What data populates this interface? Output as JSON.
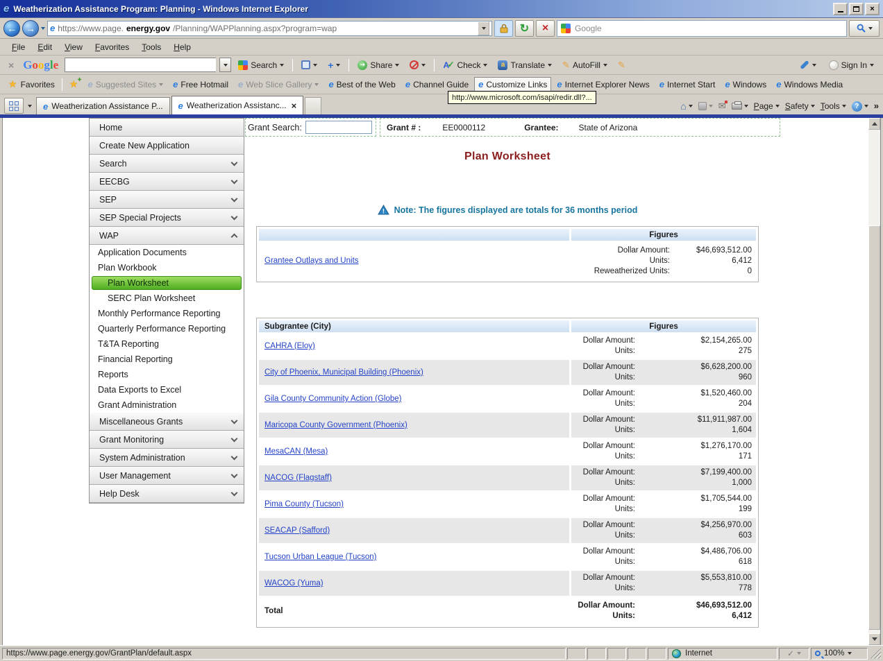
{
  "window": {
    "title": "Weatherization Assistance Program: Planning - Windows Internet Explorer",
    "url_prefix": "https://www.page.",
    "url_domain": "energy.gov",
    "url_path": "/Planning/WAPPlanning.aspx?program=wap"
  },
  "icons": {
    "close": "×",
    "back": "←",
    "forward": "→",
    "refresh": "↻",
    "stop": "×",
    "star": "★",
    "ie_e": "e",
    "home": "⌂",
    "mail": "✉",
    "overflow": "»",
    "pencil": "✎",
    "highlighter": "✎",
    "plus": "+",
    "help": "?",
    "check": "✓",
    "share_arrow": "➜",
    "tab_close": "×",
    "toolbar_close": "×"
  },
  "colors": {
    "selected_green": "#54b524",
    "title_maroon": "#8b1d1d",
    "note_teal": "#17759e",
    "link_blue": "#2442c8",
    "table_header_blue": "#cddff2",
    "google_letters": [
      "#4285f4",
      "#ea4335",
      "#fbbc05",
      "#4285f4",
      "#34a853",
      "#ea4335"
    ]
  },
  "search_engine": {
    "name": "Google",
    "box_text": "Google"
  },
  "menu_bar": [
    "File",
    "Edit",
    "View",
    "Favorites",
    "Tools",
    "Help"
  ],
  "google_toolbar": {
    "logo": "Google",
    "search_value": "",
    "search_label": "Search",
    "share_label": "Share",
    "check_label": "Check",
    "translate_label": "Translate",
    "translate_glyph": "a",
    "autofill_label": "AutoFill",
    "sign_in_label": "Sign In"
  },
  "favorites_bar": {
    "favorites_label": "Favorites",
    "links": [
      {
        "label": "Suggested Sites",
        "dropdown": true,
        "muted": true,
        "highlight": false
      },
      {
        "label": "Free Hotmail",
        "dropdown": false,
        "muted": false,
        "highlight": false
      },
      {
        "label": "Web Slice Gallery",
        "dropdown": true,
        "muted": true,
        "highlight": false
      },
      {
        "label": "Best of the Web",
        "dropdown": false,
        "muted": false,
        "highlight": false
      },
      {
        "label": "Channel Guide",
        "dropdown": false,
        "muted": false,
        "highlight": false
      },
      {
        "label": "Customize Links",
        "dropdown": false,
        "muted": false,
        "highlight": true
      },
      {
        "label": "Internet Explorer News",
        "dropdown": false,
        "muted": false,
        "highlight": false
      },
      {
        "label": "Internet Start",
        "dropdown": false,
        "muted": false,
        "highlight": false
      },
      {
        "label": "Windows",
        "dropdown": false,
        "muted": false,
        "highlight": false
      },
      {
        "label": "Windows Media",
        "dropdown": false,
        "muted": false,
        "highlight": false
      }
    ],
    "tooltip": "http://www.microsoft.com/isapi/redir.dll?..."
  },
  "tabs": [
    {
      "label": "Weatherization Assistance P...",
      "active": false,
      "closable": false
    },
    {
      "label": "Weatherization Assistanc...",
      "active": true,
      "closable": true
    }
  ],
  "command_bar": {
    "page_label": "Page",
    "safety_label": "Safety",
    "tools_label": "Tools"
  },
  "sidebar": [
    {
      "label": "Home",
      "type": "header",
      "chevron": ""
    },
    {
      "label": "Create New Application",
      "type": "header",
      "chevron": ""
    },
    {
      "label": "Search",
      "type": "header",
      "chevron": "down"
    },
    {
      "label": "EECBG",
      "type": "header",
      "chevron": "down"
    },
    {
      "label": "SEP",
      "type": "header",
      "chevron": "down"
    },
    {
      "label": "SEP Special Projects",
      "type": "header",
      "chevron": "down"
    },
    {
      "label": "WAP",
      "type": "header",
      "chevron": "up"
    },
    {
      "label": "Application Documents",
      "type": "sub",
      "chevron": ""
    },
    {
      "label": "Plan Workbook",
      "type": "sub",
      "chevron": ""
    },
    {
      "label": "Plan Worksheet",
      "type": "sub-selected",
      "chevron": ""
    },
    {
      "label": "SERC Plan Worksheet",
      "type": "sub-indent",
      "chevron": ""
    },
    {
      "label": "Monthly Performance Reporting",
      "type": "sub",
      "chevron": ""
    },
    {
      "label": "Quarterly Performance Reporting",
      "type": "sub",
      "chevron": ""
    },
    {
      "label": "T&TA Reporting",
      "type": "sub",
      "chevron": ""
    },
    {
      "label": "Financial Reporting",
      "type": "sub",
      "chevron": ""
    },
    {
      "label": "Reports",
      "type": "sub",
      "chevron": ""
    },
    {
      "label": "Data Exports to Excel",
      "type": "sub",
      "chevron": ""
    },
    {
      "label": "Grant Administration",
      "type": "sub",
      "chevron": ""
    },
    {
      "label": "Miscellaneous Grants",
      "type": "header",
      "chevron": "down"
    },
    {
      "label": "Grant Monitoring",
      "type": "header",
      "chevron": "down"
    },
    {
      "label": "System Administration",
      "type": "header",
      "chevron": "down"
    },
    {
      "label": "User Management",
      "type": "header",
      "chevron": "down"
    },
    {
      "label": "Help Desk",
      "type": "header",
      "chevron": "down"
    }
  ],
  "grant_bar": {
    "search_label": "Grant Search:",
    "search_value": "",
    "grant_number_label": "Grant # :",
    "grant_number": "EE0000112",
    "grantee_label": "Grantee:",
    "grantee": "State of Arizona"
  },
  "main": {
    "title": "Plan Worksheet",
    "note": "Note: The figures displayed are totals for 36 months period",
    "grantee_table": {
      "figures_header": "Figures",
      "link": "Grantee Outlays and Units",
      "figures": [
        {
          "label": "Dollar Amount:",
          "value": "$46,693,512.00"
        },
        {
          "label": "Units:",
          "value": "6,412"
        },
        {
          "label": "Reweatherized Units:",
          "value": "0"
        }
      ]
    },
    "subgrantee_table": {
      "col1_header": "Subgrantee (City)",
      "col2_header": "Figures",
      "dollar_label": "Dollar Amount:",
      "units_label": "Units:",
      "rows": [
        {
          "name": "CAHRA (Eloy)",
          "dollar": "$2,154,265.00",
          "units": "275"
        },
        {
          "name": "City of Phoenix, Municipal Building (Phoenix)",
          "dollar": "$6,628,200.00",
          "units": "960"
        },
        {
          "name": "Gila County Community Action (Globe)",
          "dollar": "$1,520,460.00",
          "units": "204"
        },
        {
          "name": "Maricopa County Government (Phoenix)",
          "dollar": "$11,911,987.00",
          "units": "1,604"
        },
        {
          "name": "MesaCAN (Mesa)",
          "dollar": "$1,276,170.00",
          "units": "171"
        },
        {
          "name": "NACOG (Flagstaff)",
          "dollar": "$7,199,400.00",
          "units": "1,000"
        },
        {
          "name": "Pima County (Tucson)",
          "dollar": "$1,705,544.00",
          "units": "199"
        },
        {
          "name": "SEACAP (Safford)",
          "dollar": "$4,256,970.00",
          "units": "603"
        },
        {
          "name": "Tucson Urban League (Tucson)",
          "dollar": "$4,486,706.00",
          "units": "618"
        },
        {
          "name": "WACOG (Yuma)",
          "dollar": "$5,553,810.00",
          "units": "778"
        }
      ],
      "total": {
        "name": "Total",
        "dollar": "$46,693,512.00",
        "units": "6,412"
      }
    }
  },
  "status_bar": {
    "url": "https://www.page.energy.gov/GrantPlan/default.aspx",
    "zone": "Internet",
    "zoom": "100%"
  }
}
